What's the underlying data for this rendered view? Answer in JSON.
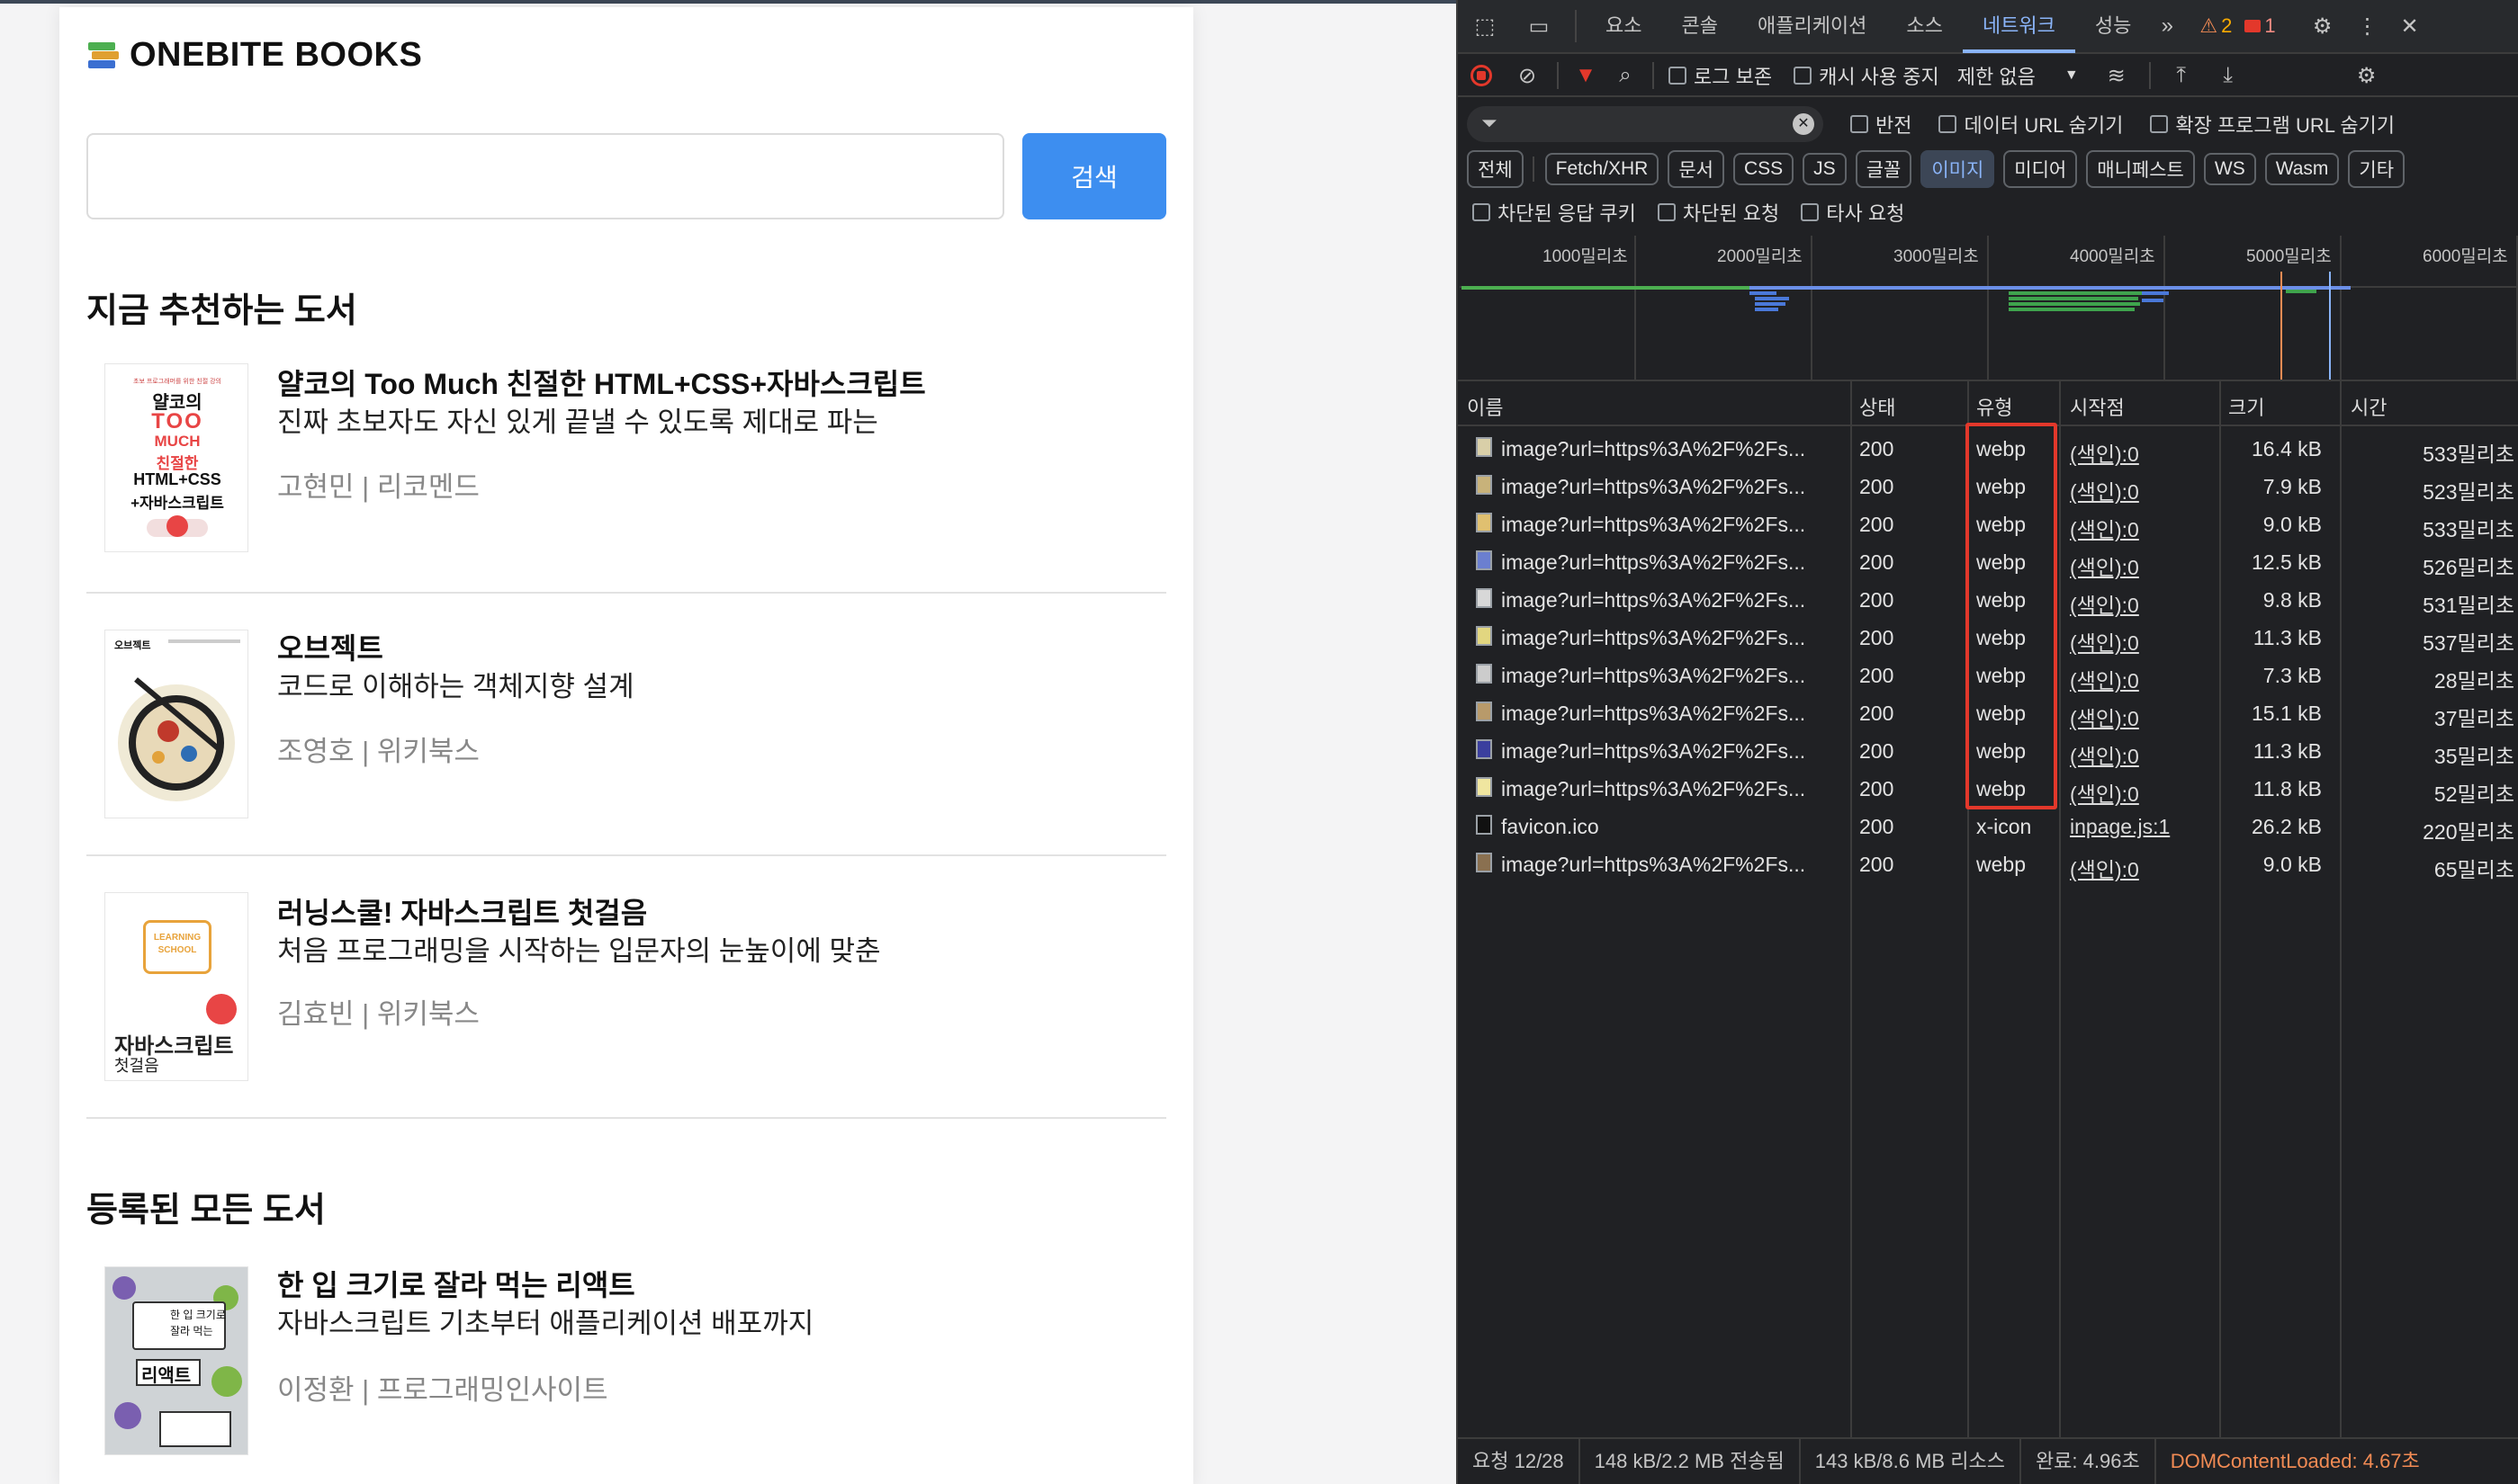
{
  "app": {
    "logo_text": "ONEBITE BOOKS",
    "search": {
      "placeholder": "",
      "button_label": "검색"
    },
    "recommended_title": "지금 추천하는 도서",
    "all_title": "등록된 모든 도서",
    "recommended_books": [
      {
        "title": "얄코의 Too Much 친절한 HTML+CSS+자바스크립트",
        "subtitle": "진짜 초보자도 자신 있게 끝낼 수 있도록 제대로 파는",
        "meta": "고현민 | 리코멘드",
        "cover_text": [
          "얄코의",
          "TOO",
          "MUCH",
          "친절한",
          "HTML+CSS",
          "+자바스크립트"
        ]
      },
      {
        "title": "오브젝트",
        "subtitle": "코드로 이해하는 객체지향 설계",
        "meta": "조영호 | 위키북스",
        "cover_text": [
          "오브젝트"
        ]
      },
      {
        "title": "러닝스쿨! 자바스크립트 첫걸음",
        "subtitle": "처음 프로그래밍을 시작하는 입문자의 눈높이에 맞춘",
        "meta": "김효빈 | 위키북스",
        "cover_text": [
          "LEARNING",
          "SCHOOL",
          "자바스크립트",
          "첫걸음"
        ]
      }
    ],
    "all_books": [
      {
        "title": "한 입 크기로 잘라 먹는 리액트",
        "subtitle": "자바스크립트 기초부터 애플리케이션 배포까지",
        "meta": "이정환 | 프로그래밍인사이트",
        "cover_text": [
          "한 입 크기로",
          "잘라 먹는",
          "리액트"
        ]
      }
    ]
  },
  "devtools": {
    "tabs": [
      "요소",
      "콘솔",
      "애플리케이션",
      "소스",
      "네트워크",
      "성능"
    ],
    "active_tab": "네트워크",
    "warning_count": "2",
    "error_count": "1",
    "toolbar": {
      "preserve_log": "로그 보존",
      "disable_cache": "캐시 사용 중지",
      "throttle": "제한 없음"
    },
    "filter": {
      "invert": "반전",
      "hide_data_urls": "데이터 URL 숨기기",
      "hide_ext_urls": "확장 프로그램 URL 숨기기"
    },
    "type_filters": [
      "전체",
      "Fetch/XHR",
      "문서",
      "CSS",
      "JS",
      "글꼴",
      "이미지",
      "미디어",
      "매니페스트",
      "WS",
      "Wasm",
      "기타"
    ],
    "active_type": "이미지",
    "options": {
      "blocked_cookies": "차단된 응답 쿠키",
      "blocked_requests": "차단된 요청",
      "third_party": "타사 요청"
    },
    "timeline_labels": [
      "1000밀리초",
      "2000밀리초",
      "3000밀리초",
      "4000밀리초",
      "5000밀리초",
      "6000밀리초"
    ],
    "columns": [
      "이름",
      "상태",
      "유형",
      "시작점",
      "크기",
      "시간"
    ],
    "rows": [
      {
        "name": "image?url=https%3A%2F%2Fs...",
        "status": "200",
        "type": "webp",
        "initiator": "(색인):0",
        "size": "16.4 kB",
        "time": "533밀리초"
      },
      {
        "name": "image?url=https%3A%2F%2Fs...",
        "status": "200",
        "type": "webp",
        "initiator": "(색인):0",
        "size": "7.9 kB",
        "time": "523밀리초"
      },
      {
        "name": "image?url=https%3A%2F%2Fs...",
        "status": "200",
        "type": "webp",
        "initiator": "(색인):0",
        "size": "9.0 kB",
        "time": "533밀리초"
      },
      {
        "name": "image?url=https%3A%2F%2Fs...",
        "status": "200",
        "type": "webp",
        "initiator": "(색인):0",
        "size": "12.5 kB",
        "time": "526밀리초"
      },
      {
        "name": "image?url=https%3A%2F%2Fs...",
        "status": "200",
        "type": "webp",
        "initiator": "(색인):0",
        "size": "9.8 kB",
        "time": "531밀리초"
      },
      {
        "name": "image?url=https%3A%2F%2Fs...",
        "status": "200",
        "type": "webp",
        "initiator": "(색인):0",
        "size": "11.3 kB",
        "time": "537밀리초"
      },
      {
        "name": "image?url=https%3A%2F%2Fs...",
        "status": "200",
        "type": "webp",
        "initiator": "(색인):0",
        "size": "7.3 kB",
        "time": "28밀리초"
      },
      {
        "name": "image?url=https%3A%2F%2Fs...",
        "status": "200",
        "type": "webp",
        "initiator": "(색인):0",
        "size": "15.1 kB",
        "time": "37밀리초"
      },
      {
        "name": "image?url=https%3A%2F%2Fs...",
        "status": "200",
        "type": "webp",
        "initiator": "(색인):0",
        "size": "11.3 kB",
        "time": "35밀리초"
      },
      {
        "name": "image?url=https%3A%2F%2Fs...",
        "status": "200",
        "type": "webp",
        "initiator": "(색인):0",
        "size": "11.8 kB",
        "time": "52밀리초"
      },
      {
        "name": "favicon.ico",
        "status": "200",
        "type": "x-icon",
        "initiator": "inpage.js:1",
        "size": "26.2 kB",
        "time": "220밀리초"
      },
      {
        "name": "image?url=https%3A%2F%2Fs...",
        "status": "200",
        "type": "webp",
        "initiator": "(색인):0",
        "size": "9.0 kB",
        "time": "65밀리초"
      }
    ],
    "status_bar": [
      "요청 12/28",
      "148 kB/2.2 MB 전송됨",
      "143 kB/8.6 MB 리소스",
      "완료: 4.96초",
      "DOMContentLoaded: 4.67초"
    ],
    "colors": {
      "accent": "#8ab4f8",
      "highlight": "#e3382b",
      "dcl": "#f28b54"
    }
  }
}
